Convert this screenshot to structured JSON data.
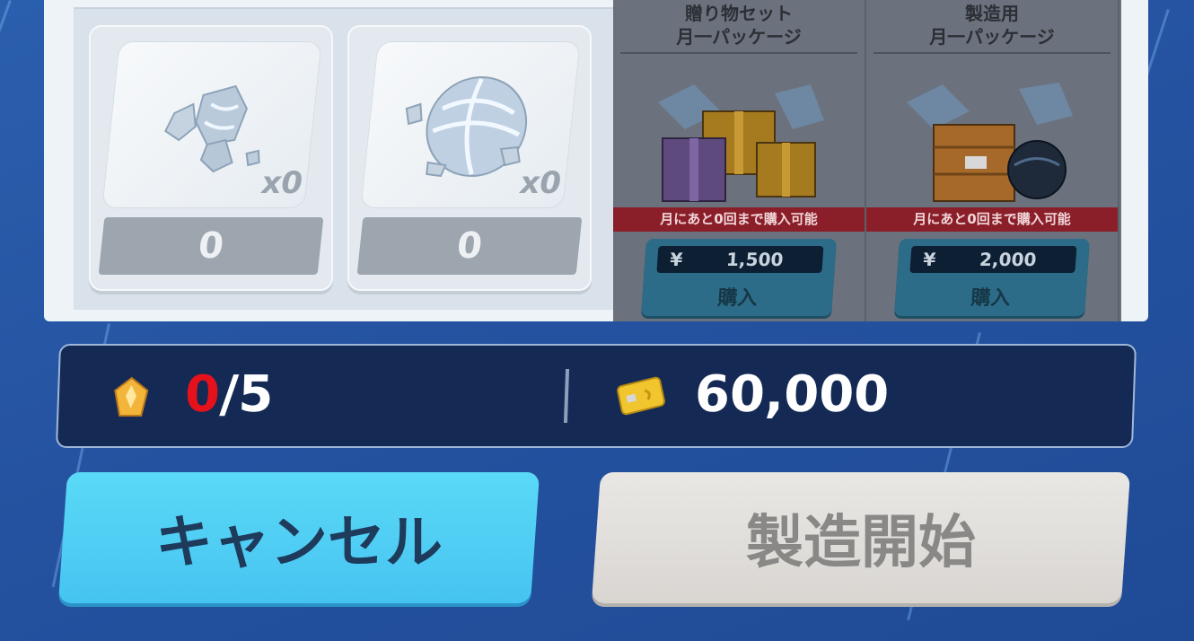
{
  "materials": [
    {
      "name": "crystal-shards",
      "qty": "x0",
      "count": "0"
    },
    {
      "name": "crystal-orb",
      "qty": "x0",
      "count": "0"
    }
  ],
  "shop": {
    "packages": [
      {
        "title_line1": "贈り物セット",
        "title_line2": "月一パッケージ",
        "limit": "月にあと0回まで購入可能",
        "currency": "¥",
        "price": "1,500",
        "buy_label": "購入"
      },
      {
        "title_line1": "製造用",
        "title_line2": "月一パッケージ",
        "limit": "月にあと0回まで購入可能",
        "currency": "¥",
        "price": "2,000",
        "buy_label": "購入"
      }
    ]
  },
  "resources": {
    "crystal_current": "0",
    "crystal_max": "/5",
    "money": "60,000"
  },
  "buttons": {
    "cancel": "キャンセル",
    "start": "製造開始"
  },
  "colors": {
    "background": "#2553a1",
    "cancel_button": "#4fcff4",
    "start_button_disabled": "#dedbd7",
    "limit_banner": "#8a1f29",
    "count_highlight": "#e5121b"
  }
}
